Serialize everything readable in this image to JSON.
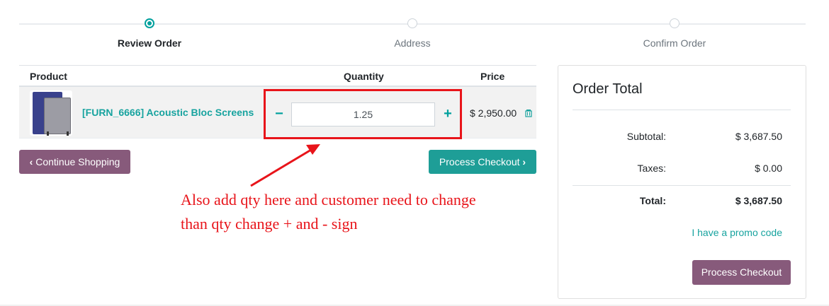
{
  "wizard": {
    "steps": [
      {
        "label": "Review Order",
        "state": "active"
      },
      {
        "label": "Address",
        "state": "pending"
      },
      {
        "label": "Confirm Order",
        "state": "pending"
      }
    ]
  },
  "cart": {
    "columns": {
      "product": "Product",
      "quantity": "Quantity",
      "price": "Price"
    },
    "items": [
      {
        "name": "[FURN_6666] Acoustic Bloc Screens",
        "quantity": "1.25",
        "minus": "−",
        "plus": "+",
        "price": "$ 2,950.00",
        "remove_icon": "trash-icon"
      }
    ],
    "continue_label": "Continue Shopping",
    "process_label": "Process Checkout"
  },
  "annotation": {
    "text": "Also add qty here and customer need to change than qty change + and - sign",
    "color": "#e8141a"
  },
  "summary": {
    "title": "Order Total",
    "subtotal_label": "Subtotal:",
    "subtotal_value": "$ 3,687.50",
    "taxes_label": "Taxes:",
    "taxes_value": "$ 0.00",
    "total_label": "Total:",
    "total_value": "$ 3,687.50",
    "promo_label": "I have a promo code",
    "checkout_label": "Process Checkout"
  },
  "colors": {
    "primary": "#875a7b",
    "accent": "#00a09d",
    "annotation": "#e8141a"
  }
}
